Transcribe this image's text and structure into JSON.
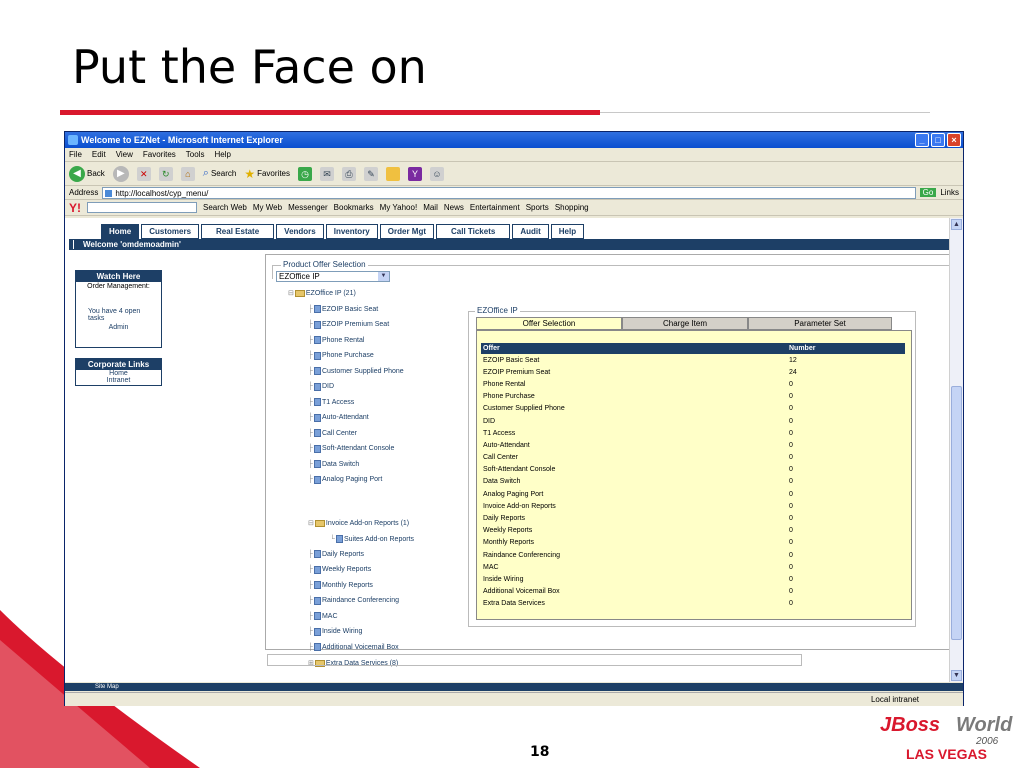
{
  "slide": {
    "title": "Put the Face on",
    "page_number": "18",
    "logo": {
      "jboss": "JBoss",
      "world": "World",
      "year": "2006",
      "city": "LAS VEGAS"
    }
  },
  "browser": {
    "title": "Welcome to EZNet - Microsoft Internet Explorer",
    "menu": [
      "File",
      "Edit",
      "View",
      "Favorites",
      "Tools",
      "Help"
    ],
    "toolbar": {
      "back": "Back",
      "search": "Search",
      "favorites": "Favorites"
    },
    "address": {
      "label": "Address",
      "url": "http://localhost/cyp_menu/",
      "go": "Go",
      "links": "Links"
    },
    "yahoo": {
      "search_web": "Search Web",
      "items": [
        "My Web",
        "Messenger",
        "Bookmarks",
        "My Yahoo!",
        "Mail",
        "News",
        "Entertainment",
        "Sports",
        "Shopping"
      ]
    },
    "status": {
      "zone": "Local intranet",
      "sitemap": "Site Map"
    }
  },
  "app": {
    "nav_tabs": [
      "Home",
      "Customers",
      "Real Estate",
      "Vendors",
      "Inventory",
      "Order Mgt",
      "Call Tickets",
      "Audit",
      "Help"
    ],
    "welcome": "Welcome 'omdemoadmin'",
    "watch_here": {
      "header": "Watch Here",
      "title": "Order Management:",
      "tasks": "You have 4 open tasks",
      "user": "Admin"
    },
    "corporate_links": {
      "header": "Corporate Links",
      "home": "Home",
      "intranet": "Intranet"
    },
    "product_offer": {
      "label": "Product Offer Selection",
      "selected": "EZOffice IP"
    },
    "tree": {
      "root": "EZOffice IP (21)",
      "items": [
        "EZOIP Basic Seat",
        "EZOIP Premium Seat",
        "Phone Rental",
        "Phone Purchase",
        "Customer Supplied Phone",
        "DID",
        "T1 Access",
        "Auto-Attendant",
        "Call Center",
        "Soft-Attendant Console",
        "Data Switch",
        "Analog Paging Port"
      ],
      "invoice_group": "Invoice Add-on Reports (1)",
      "invoice_child": "Suites Add-on Reports",
      "items2": [
        "Daily Reports",
        "Weekly Reports",
        "Monthly Reports",
        "Raindance Conferencing",
        "MAC",
        "Inside Wiring",
        "Additional Voicemail Box"
      ],
      "extra": "Extra Data Services (8)"
    },
    "offer_panel": {
      "label": "EZOffice IP",
      "tabs": [
        "Offer Selection",
        "Charge Item",
        "Parameter Set"
      ],
      "headers": [
        "Offer",
        "Number"
      ],
      "rows": [
        [
          "EZOIP Basic Seat",
          "12"
        ],
        [
          "EZOIP Premium Seat",
          "24"
        ],
        [
          "Phone Rental",
          "0"
        ],
        [
          "Phone Purchase",
          "0"
        ],
        [
          "Customer Supplied Phone",
          "0"
        ],
        [
          "DID",
          "0"
        ],
        [
          "T1 Access",
          "0"
        ],
        [
          "Auto-Attendant",
          "0"
        ],
        [
          "Call Center",
          "0"
        ],
        [
          "Soft-Attendant Console",
          "0"
        ],
        [
          "Data Switch",
          "0"
        ],
        [
          "Analog Paging Port",
          "0"
        ],
        [
          "Invoice Add-on Reports",
          "0"
        ],
        [
          "Daily Reports",
          "0"
        ],
        [
          "Weekly Reports",
          "0"
        ],
        [
          "Monthly Reports",
          "0"
        ],
        [
          "Raindance Conferencing",
          "0"
        ],
        [
          "MAC",
          "0"
        ],
        [
          "Inside Wiring",
          "0"
        ],
        [
          "Additional Voicemail Box",
          "0"
        ],
        [
          "Extra Data Services",
          "0"
        ]
      ]
    }
  }
}
